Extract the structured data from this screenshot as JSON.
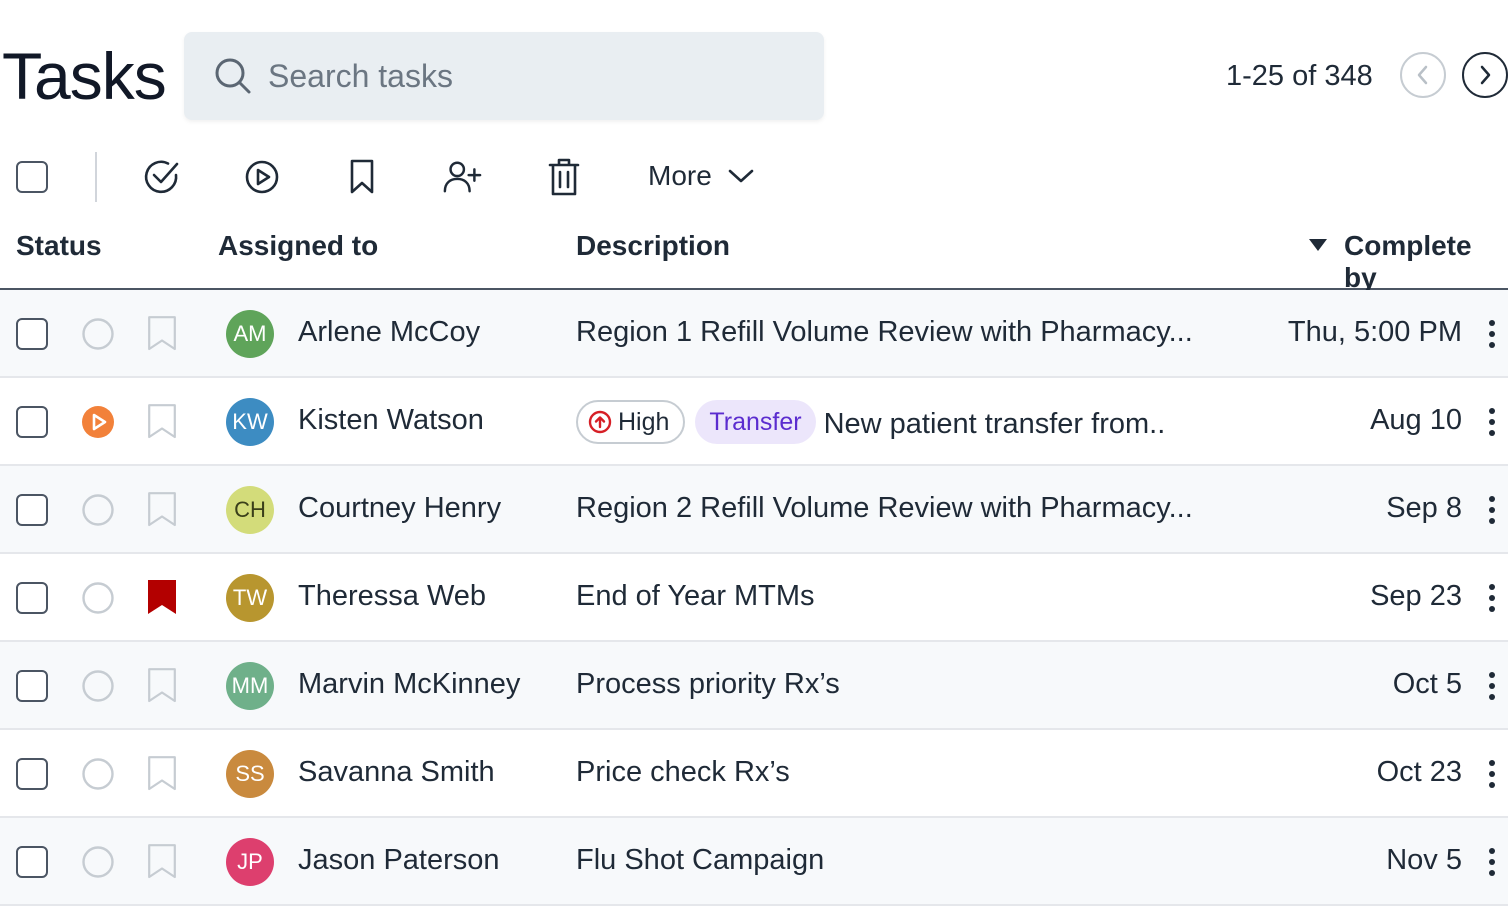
{
  "header": {
    "title": "Tasks",
    "search_placeholder": "Search tasks",
    "pagination": "1-25 of 348"
  },
  "toolbar": {
    "more_label": "More"
  },
  "columns": {
    "status": "Status",
    "assigned_to": "Assigned to",
    "description": "Description",
    "complete_by": "Complete by"
  },
  "rows": [
    {
      "initials": "AM",
      "name": "Arlene McCoy",
      "description": "Region 1 Refill Volume Review with Pharmacy...",
      "due": "Thu, 5:00 PM",
      "status": "not-started",
      "flagged": false,
      "avatar_color": "#5fa45a"
    },
    {
      "initials": "KW",
      "name": "Kisten Watson",
      "priority": "High",
      "tag": "Transfer",
      "description": "New patient transfer from..",
      "due": "Aug 10",
      "status": "in-progress",
      "flagged": false,
      "avatar_color": "#3d8cc2"
    },
    {
      "initials": "CH",
      "name": "Courtney Henry",
      "description": "Region 2 Refill Volume Review with Pharmacy...",
      "due": "Sep 8",
      "status": "not-started",
      "flagged": false,
      "avatar_color": "#d3dc7a"
    },
    {
      "initials": "TW",
      "name": "Theressa Web",
      "description": "End of Year MTMs",
      "due": "Sep 23",
      "status": "not-started",
      "flagged": true,
      "avatar_color": "#b8962f"
    },
    {
      "initials": "MM",
      "name": "Marvin McKinney",
      "description": "Process priority Rx’s",
      "due": "Oct 5",
      "status": "not-started",
      "flagged": false,
      "avatar_color": "#6fb08a"
    },
    {
      "initials": "SS",
      "name": "Savanna Smith",
      "description": "Price check Rx’s",
      "due": "Oct 23",
      "status": "not-started",
      "flagged": false,
      "avatar_color": "#c98a3e"
    },
    {
      "initials": "JP",
      "name": "Jason Paterson",
      "description": "Flu Shot Campaign",
      "due": "Nov 5",
      "status": "not-started",
      "flagged": false,
      "avatar_color": "#dd3f6e"
    }
  ],
  "colors": {
    "in_progress": "#f2813a",
    "flag": "#b30000",
    "high_priority": "#d61f26",
    "transfer_bg": "#ece6fb",
    "transfer_text": "#5b2ccf"
  }
}
